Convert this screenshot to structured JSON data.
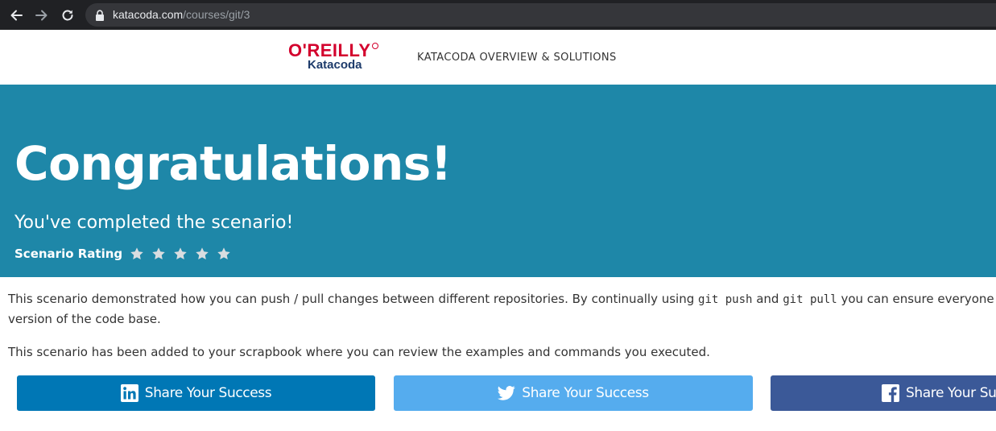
{
  "browser": {
    "url_domain": "katacoda.com",
    "url_path": "/courses/git/3"
  },
  "header": {
    "logo_top": "O'REILLY",
    "logo_bottom": "Katacoda",
    "nav_link": "KATACODA OVERVIEW & SOLUTIONS"
  },
  "hero": {
    "title": "Congratulations!",
    "subtitle": "You've completed the scenario!",
    "rating_label": "Scenario Rating",
    "rating_max": 5
  },
  "body": {
    "para1_before": "This scenario demonstrated how you can push / pull changes between different repositories. By continually using ",
    "para1_code1": "git push",
    "para1_mid": " and ",
    "para1_code2": "git pull",
    "para1_after": " you can ensure everyone",
    "para1_line2": "version of the code base.",
    "para2": "This scenario has been added to your scrapbook where you can review the examples and commands you executed."
  },
  "share": {
    "linkedin_label": "Share Your Success",
    "twitter_label": "Share Your Success",
    "facebook_label": "Share Your Succ"
  },
  "colors": {
    "hero_bg": "#1e87a8",
    "linkedin": "#0077b5",
    "twitter": "#55acee",
    "facebook": "#3b5998",
    "oreilly_red": "#d3002d",
    "katacoda_navy": "#1d3b6b"
  },
  "icons": {
    "back": "arrow-left-icon",
    "forward": "arrow-right-icon",
    "reload": "reload-icon",
    "lock": "lock-icon",
    "star": "star-icon",
    "linkedin": "linkedin-icon",
    "twitter": "twitter-icon",
    "facebook": "facebook-icon"
  }
}
